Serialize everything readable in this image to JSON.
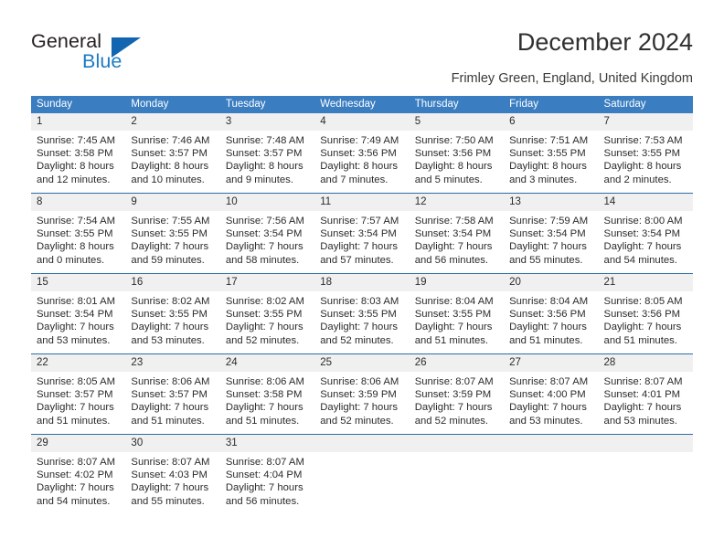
{
  "brand": {
    "name_top": "General",
    "name_bottom": "Blue",
    "triangle_color": "#1265b0",
    "blue_color": "#1a7bc4"
  },
  "header": {
    "title": "December 2024",
    "location": "Frimley Green, England, United Kingdom"
  },
  "theme": {
    "header_blue": "#3a7dc0",
    "rule_blue": "#2f6ca6",
    "number_band_gray": "#f0f0f0",
    "text": "#2b2b2b"
  },
  "weekday_headers": [
    "Sunday",
    "Monday",
    "Tuesday",
    "Wednesday",
    "Thursday",
    "Friday",
    "Saturday"
  ],
  "weeks": [
    {
      "days": [
        {
          "num": "1",
          "sunrise": "Sunrise: 7:45 AM",
          "sunset": "Sunset: 3:58 PM",
          "daylight1": "Daylight: 8 hours",
          "daylight2": "and 12 minutes."
        },
        {
          "num": "2",
          "sunrise": "Sunrise: 7:46 AM",
          "sunset": "Sunset: 3:57 PM",
          "daylight1": "Daylight: 8 hours",
          "daylight2": "and 10 minutes."
        },
        {
          "num": "3",
          "sunrise": "Sunrise: 7:48 AM",
          "sunset": "Sunset: 3:57 PM",
          "daylight1": "Daylight: 8 hours",
          "daylight2": "and 9 minutes."
        },
        {
          "num": "4",
          "sunrise": "Sunrise: 7:49 AM",
          "sunset": "Sunset: 3:56 PM",
          "daylight1": "Daylight: 8 hours",
          "daylight2": "and 7 minutes."
        },
        {
          "num": "5",
          "sunrise": "Sunrise: 7:50 AM",
          "sunset": "Sunset: 3:56 PM",
          "daylight1": "Daylight: 8 hours",
          "daylight2": "and 5 minutes."
        },
        {
          "num": "6",
          "sunrise": "Sunrise: 7:51 AM",
          "sunset": "Sunset: 3:55 PM",
          "daylight1": "Daylight: 8 hours",
          "daylight2": "and 3 minutes."
        },
        {
          "num": "7",
          "sunrise": "Sunrise: 7:53 AM",
          "sunset": "Sunset: 3:55 PM",
          "daylight1": "Daylight: 8 hours",
          "daylight2": "and 2 minutes."
        }
      ]
    },
    {
      "days": [
        {
          "num": "8",
          "sunrise": "Sunrise: 7:54 AM",
          "sunset": "Sunset: 3:55 PM",
          "daylight1": "Daylight: 8 hours",
          "daylight2": "and 0 minutes."
        },
        {
          "num": "9",
          "sunrise": "Sunrise: 7:55 AM",
          "sunset": "Sunset: 3:55 PM",
          "daylight1": "Daylight: 7 hours",
          "daylight2": "and 59 minutes."
        },
        {
          "num": "10",
          "sunrise": "Sunrise: 7:56 AM",
          "sunset": "Sunset: 3:54 PM",
          "daylight1": "Daylight: 7 hours",
          "daylight2": "and 58 minutes."
        },
        {
          "num": "11",
          "sunrise": "Sunrise: 7:57 AM",
          "sunset": "Sunset: 3:54 PM",
          "daylight1": "Daylight: 7 hours",
          "daylight2": "and 57 minutes."
        },
        {
          "num": "12",
          "sunrise": "Sunrise: 7:58 AM",
          "sunset": "Sunset: 3:54 PM",
          "daylight1": "Daylight: 7 hours",
          "daylight2": "and 56 minutes."
        },
        {
          "num": "13",
          "sunrise": "Sunrise: 7:59 AM",
          "sunset": "Sunset: 3:54 PM",
          "daylight1": "Daylight: 7 hours",
          "daylight2": "and 55 minutes."
        },
        {
          "num": "14",
          "sunrise": "Sunrise: 8:00 AM",
          "sunset": "Sunset: 3:54 PM",
          "daylight1": "Daylight: 7 hours",
          "daylight2": "and 54 minutes."
        }
      ]
    },
    {
      "days": [
        {
          "num": "15",
          "sunrise": "Sunrise: 8:01 AM",
          "sunset": "Sunset: 3:54 PM",
          "daylight1": "Daylight: 7 hours",
          "daylight2": "and 53 minutes."
        },
        {
          "num": "16",
          "sunrise": "Sunrise: 8:02 AM",
          "sunset": "Sunset: 3:55 PM",
          "daylight1": "Daylight: 7 hours",
          "daylight2": "and 53 minutes."
        },
        {
          "num": "17",
          "sunrise": "Sunrise: 8:02 AM",
          "sunset": "Sunset: 3:55 PM",
          "daylight1": "Daylight: 7 hours",
          "daylight2": "and 52 minutes."
        },
        {
          "num": "18",
          "sunrise": "Sunrise: 8:03 AM",
          "sunset": "Sunset: 3:55 PM",
          "daylight1": "Daylight: 7 hours",
          "daylight2": "and 52 minutes."
        },
        {
          "num": "19",
          "sunrise": "Sunrise: 8:04 AM",
          "sunset": "Sunset: 3:55 PM",
          "daylight1": "Daylight: 7 hours",
          "daylight2": "and 51 minutes."
        },
        {
          "num": "20",
          "sunrise": "Sunrise: 8:04 AM",
          "sunset": "Sunset: 3:56 PM",
          "daylight1": "Daylight: 7 hours",
          "daylight2": "and 51 minutes."
        },
        {
          "num": "21",
          "sunrise": "Sunrise: 8:05 AM",
          "sunset": "Sunset: 3:56 PM",
          "daylight1": "Daylight: 7 hours",
          "daylight2": "and 51 minutes."
        }
      ]
    },
    {
      "days": [
        {
          "num": "22",
          "sunrise": "Sunrise: 8:05 AM",
          "sunset": "Sunset: 3:57 PM",
          "daylight1": "Daylight: 7 hours",
          "daylight2": "and 51 minutes."
        },
        {
          "num": "23",
          "sunrise": "Sunrise: 8:06 AM",
          "sunset": "Sunset: 3:57 PM",
          "daylight1": "Daylight: 7 hours",
          "daylight2": "and 51 minutes."
        },
        {
          "num": "24",
          "sunrise": "Sunrise: 8:06 AM",
          "sunset": "Sunset: 3:58 PM",
          "daylight1": "Daylight: 7 hours",
          "daylight2": "and 51 minutes."
        },
        {
          "num": "25",
          "sunrise": "Sunrise: 8:06 AM",
          "sunset": "Sunset: 3:59 PM",
          "daylight1": "Daylight: 7 hours",
          "daylight2": "and 52 minutes."
        },
        {
          "num": "26",
          "sunrise": "Sunrise: 8:07 AM",
          "sunset": "Sunset: 3:59 PM",
          "daylight1": "Daylight: 7 hours",
          "daylight2": "and 52 minutes."
        },
        {
          "num": "27",
          "sunrise": "Sunrise: 8:07 AM",
          "sunset": "Sunset: 4:00 PM",
          "daylight1": "Daylight: 7 hours",
          "daylight2": "and 53 minutes."
        },
        {
          "num": "28",
          "sunrise": "Sunrise: 8:07 AM",
          "sunset": "Sunset: 4:01 PM",
          "daylight1": "Daylight: 7 hours",
          "daylight2": "and 53 minutes."
        }
      ]
    },
    {
      "days": [
        {
          "num": "29",
          "sunrise": "Sunrise: 8:07 AM",
          "sunset": "Sunset: 4:02 PM",
          "daylight1": "Daylight: 7 hours",
          "daylight2": "and 54 minutes."
        },
        {
          "num": "30",
          "sunrise": "Sunrise: 8:07 AM",
          "sunset": "Sunset: 4:03 PM",
          "daylight1": "Daylight: 7 hours",
          "daylight2": "and 55 minutes."
        },
        {
          "num": "31",
          "sunrise": "Sunrise: 8:07 AM",
          "sunset": "Sunset: 4:04 PM",
          "daylight1": "Daylight: 7 hours",
          "daylight2": "and 56 minutes."
        },
        {
          "num": "",
          "sunrise": "",
          "sunset": "",
          "daylight1": "",
          "daylight2": ""
        },
        {
          "num": "",
          "sunrise": "",
          "sunset": "",
          "daylight1": "",
          "daylight2": ""
        },
        {
          "num": "",
          "sunrise": "",
          "sunset": "",
          "daylight1": "",
          "daylight2": ""
        },
        {
          "num": "",
          "sunrise": "",
          "sunset": "",
          "daylight1": "",
          "daylight2": ""
        }
      ]
    }
  ]
}
